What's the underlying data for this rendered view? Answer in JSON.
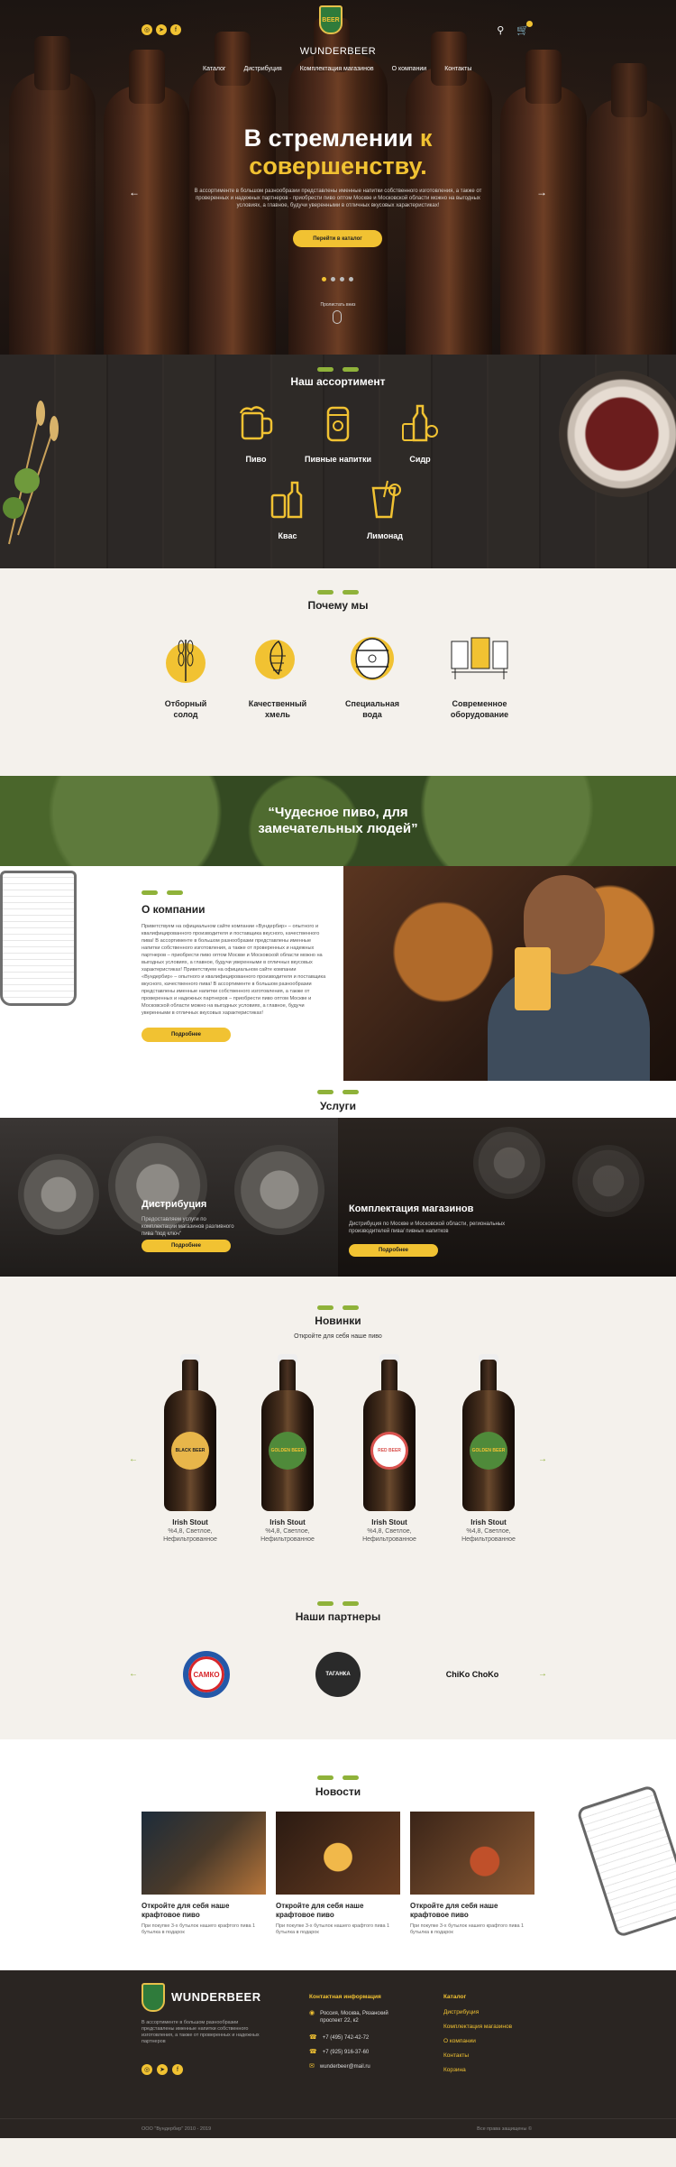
{
  "header": {
    "logo_badge": "BEER",
    "logo_text": "WUNDERBEER",
    "nav": [
      "Каталог",
      "Дистрибуция",
      "Комплектация магазинов",
      "О компании",
      "Контакты"
    ],
    "social_icons": [
      "instagram-icon",
      "telegram-icon",
      "facebook-icon"
    ],
    "right_icons": [
      "search-icon",
      "cart-icon"
    ]
  },
  "hero": {
    "title_line1": "В стремлении",
    "title_highlight1": "к",
    "title_line2": "совершенству.",
    "lead": "В ассортименте в большом разнообразии представлены именные напитки собственного изготовления, а также от проверенных и надежных партнеров - приобрести пиво оптом Москве и Московской области можно на выгодных условиях, а главное, будучи уверенными в отличных вкусовых характеристиках!",
    "cta": "Перейти в каталог",
    "scroll_label": "Пролистать вниз",
    "slides": 4,
    "active_slide": 1
  },
  "assortment": {
    "title": "Наш ассортимент",
    "items": [
      "Пиво",
      "Пивные напитки",
      "Сидр",
      "Квас",
      "Лимонад"
    ]
  },
  "why": {
    "title": "Почему мы",
    "items": [
      {
        "line1": "Отборный",
        "line2": "солод"
      },
      {
        "line1": "Качественный",
        "line2": "хмель"
      },
      {
        "line1": "Специальная",
        "line2": "вода"
      },
      {
        "line1": "Современное",
        "line2": "оборудование"
      }
    ]
  },
  "quote": {
    "line1": "“Чудесное пиво, для",
    "line2": "замечательных людей”"
  },
  "about": {
    "title": "О компании",
    "body": "Приветствуем на официальном сайте компании «Вундербир» – опытного и квалифицированного производителя и поставщика вкусного, качественного пива! В ассортименте в большом разнообразии представлены именные напитки собственного изготовления, а также от проверенных и надежных партнеров – приобрести пиво оптом Москве и Московской области можно на выгодных условиях, а главное, будучи уверенными в отличных вкусовых характеристиках! Приветствуем на официальном сайте компании «Вундербир» – опытного и квалифицированного производителя и поставщика вкусного, качественного пива! В ассортименте в большом разнообразии представлены именные напитки собственного изготовления, а также от проверенных и надежных партнеров – приобрести пиво оптом Москве и Московской области можно на выгодных условиях, а главное, будучи уверенными в отличных вкусовых характеристиках!",
    "button": "Подробнее"
  },
  "services": {
    "title": "Услуги",
    "items": [
      {
        "title": "Дистрибуция",
        "text": "Предоставляем услуги по комплектации магазинов разливного пива \"под ключ\"",
        "button": "Подробнее"
      },
      {
        "title": "Комплектация магазинов",
        "text": "Дистрибуция по Москве и Московской области, региональных производителей пива/ пивных напитков",
        "button": "Подробнее"
      }
    ]
  },
  "new_products": {
    "title": "Новинки",
    "subtitle": "Откройте для себя наше пиво",
    "items": [
      {
        "name": "Irish Stout",
        "desc1": "%4,8, Светлое,",
        "desc2": "Нефильтрованное",
        "label": "BLACK BEER",
        "label_color": "#e8b64a"
      },
      {
        "name": "Irish Stout",
        "desc1": "%4,8, Светлое,",
        "desc2": "Нефильтрованное",
        "label": "GOLDEN BEER",
        "label_color": "#4f8a3a"
      },
      {
        "name": "Irish Stout",
        "desc1": "%4,8, Светлое,",
        "desc2": "Нефильтрованное",
        "label": "RED BEER",
        "label_color": "#d9534f"
      },
      {
        "name": "Irish Stout",
        "desc1": "%4,8, Светлое,",
        "desc2": "Нефильтрованное",
        "label": "GOLDEN BEER",
        "label_color": "#4f8a3a"
      }
    ]
  },
  "partners": {
    "title": "Наши партнеры",
    "items": [
      "САМКО",
      "ТАГАНКА",
      "ChiKo ChoKo"
    ]
  },
  "blog": {
    "title": "Новости",
    "posts": [
      {
        "title": "Откройте для себя наше крафтовое пиво",
        "text": "При покупке 3-х бутылок нашего крафтого пива 1 бутылка в подарок"
      },
      {
        "title": "Откройте для себя наше крафтовое пиво",
        "text": "При покупке 3-х бутылок нашего крафтого пива 1 бутылка в подарок"
      },
      {
        "title": "Откройте для себя наше крафтовое пиво",
        "text": "При покупке 3-х бутылок нашего крафтого пива 1 бутылка в подарок"
      }
    ]
  },
  "footer": {
    "logo_text": "WUNDERBEER",
    "desc": "В ассортименте в большом разнообразии представлены именные напитки собственного изготовления, а также от проверенных и надежных партнеров",
    "contacts_title": "Контактная информация",
    "address_line1": "Россия, Москва, Рязанский",
    "address_line2": "проспект 22, к2",
    "phone1": "+7 (495) 742-42-72",
    "phone2": "+7 (925) 916-37-60",
    "email": "wunderbeer@mail.ru",
    "catalog_title": "Каталог",
    "links": [
      "Дистрибуция",
      "Комплектация магазинов",
      "О компании",
      "Контакты",
      "Корзина"
    ],
    "copyright": "ООО \"Вундербир\" 2010 - 2019",
    "developer": "Все права защищены ©"
  },
  "colors": {
    "accent": "#f1c232",
    "green": "#8fb23a",
    "dark": "#2a2522"
  }
}
